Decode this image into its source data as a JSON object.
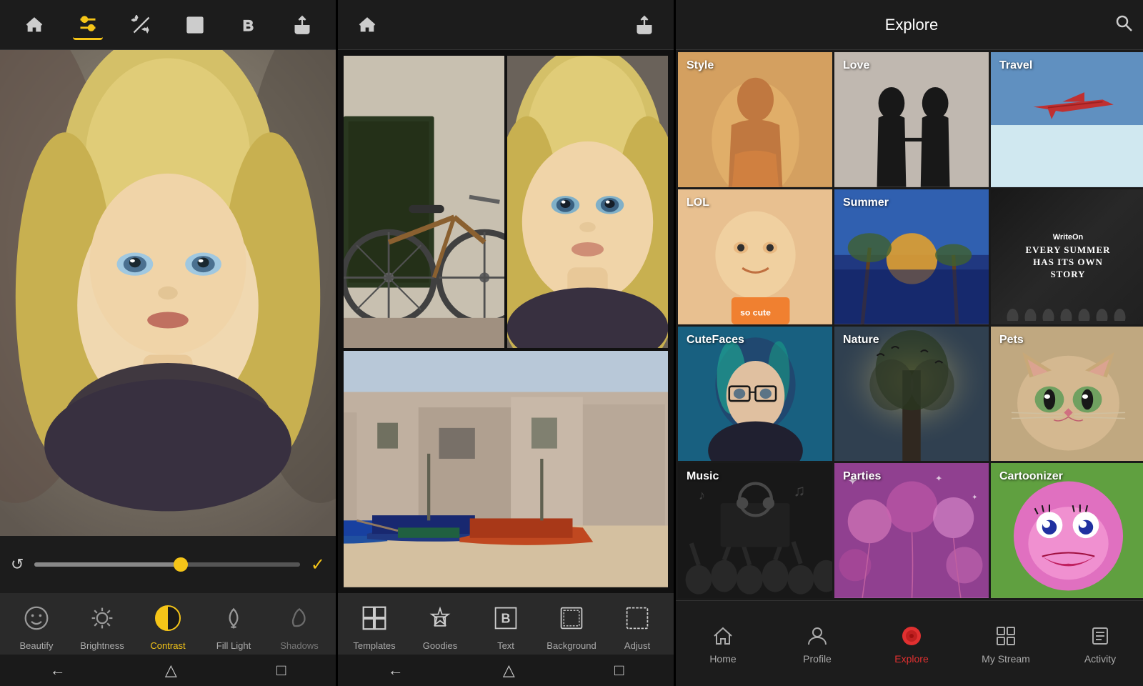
{
  "panels": {
    "editor": {
      "toolbar": {
        "icons": [
          {
            "name": "home",
            "glyph": "⌂",
            "active": false
          },
          {
            "name": "sliders",
            "glyph": "⊜",
            "active": true
          },
          {
            "name": "wand",
            "glyph": "✦",
            "active": false
          },
          {
            "name": "frame",
            "glyph": "▢",
            "active": false
          },
          {
            "name": "bold-b",
            "glyph": "B",
            "active": false
          },
          {
            "name": "share",
            "glyph": "↗",
            "active": false
          }
        ]
      },
      "slider": {
        "fill_percent": 55
      },
      "tools": [
        {
          "id": "beautify",
          "label": "Beautify",
          "active": false
        },
        {
          "id": "brightness",
          "label": "Brightness",
          "active": false
        },
        {
          "id": "contrast",
          "label": "Contrast",
          "active": true
        },
        {
          "id": "fill-light",
          "label": "Fill Light",
          "active": false
        },
        {
          "id": "shadows",
          "label": "Shadows",
          "active": false
        }
      ],
      "nav": [
        "←",
        "△",
        "□"
      ]
    },
    "collage": {
      "toolbar": {
        "left_icon": "⌂",
        "right_icon": "↗"
      },
      "tools": [
        {
          "id": "templates",
          "label": "Templates"
        },
        {
          "id": "goodies",
          "label": "Goodies"
        },
        {
          "id": "text",
          "label": "Text"
        },
        {
          "id": "background",
          "label": "Background"
        },
        {
          "id": "adjust",
          "label": "Adjust"
        }
      ],
      "nav": [
        "←",
        "△",
        "□"
      ]
    },
    "explore": {
      "title": "Explore",
      "search_icon": "🔍",
      "categories": [
        {
          "id": "style",
          "label": "Style",
          "bg": "style"
        },
        {
          "id": "love",
          "label": "Love",
          "bg": "love"
        },
        {
          "id": "travel",
          "label": "Travel",
          "bg": "travel"
        },
        {
          "id": "lol",
          "label": "LOL",
          "bg": "lol"
        },
        {
          "id": "summer",
          "label": "Summer",
          "bg": "summer"
        },
        {
          "id": "writeon",
          "label": "WriteOn",
          "bg": "writeon",
          "subtitle": "EVERY SUMMER HAS ITS OWN STORY"
        },
        {
          "id": "cutefaces",
          "label": "CuteFaces",
          "bg": "cutefaces"
        },
        {
          "id": "nature",
          "label": "Nature",
          "bg": "nature"
        },
        {
          "id": "pets",
          "label": "Pets",
          "bg": "pets"
        },
        {
          "id": "music",
          "label": "Music",
          "bg": "music"
        },
        {
          "id": "parties",
          "label": "Parties",
          "bg": "parties"
        },
        {
          "id": "cartoonizer",
          "label": "Cartoonizer",
          "bg": "cartoonizer"
        }
      ],
      "nav": [
        {
          "id": "home",
          "label": "Home",
          "active": false
        },
        {
          "id": "profile",
          "label": "Profile",
          "active": false
        },
        {
          "id": "explore",
          "label": "Explore",
          "active": true
        },
        {
          "id": "mystream",
          "label": "My Stream",
          "active": false
        },
        {
          "id": "activity",
          "label": "Activity",
          "active": false
        }
      ]
    }
  }
}
